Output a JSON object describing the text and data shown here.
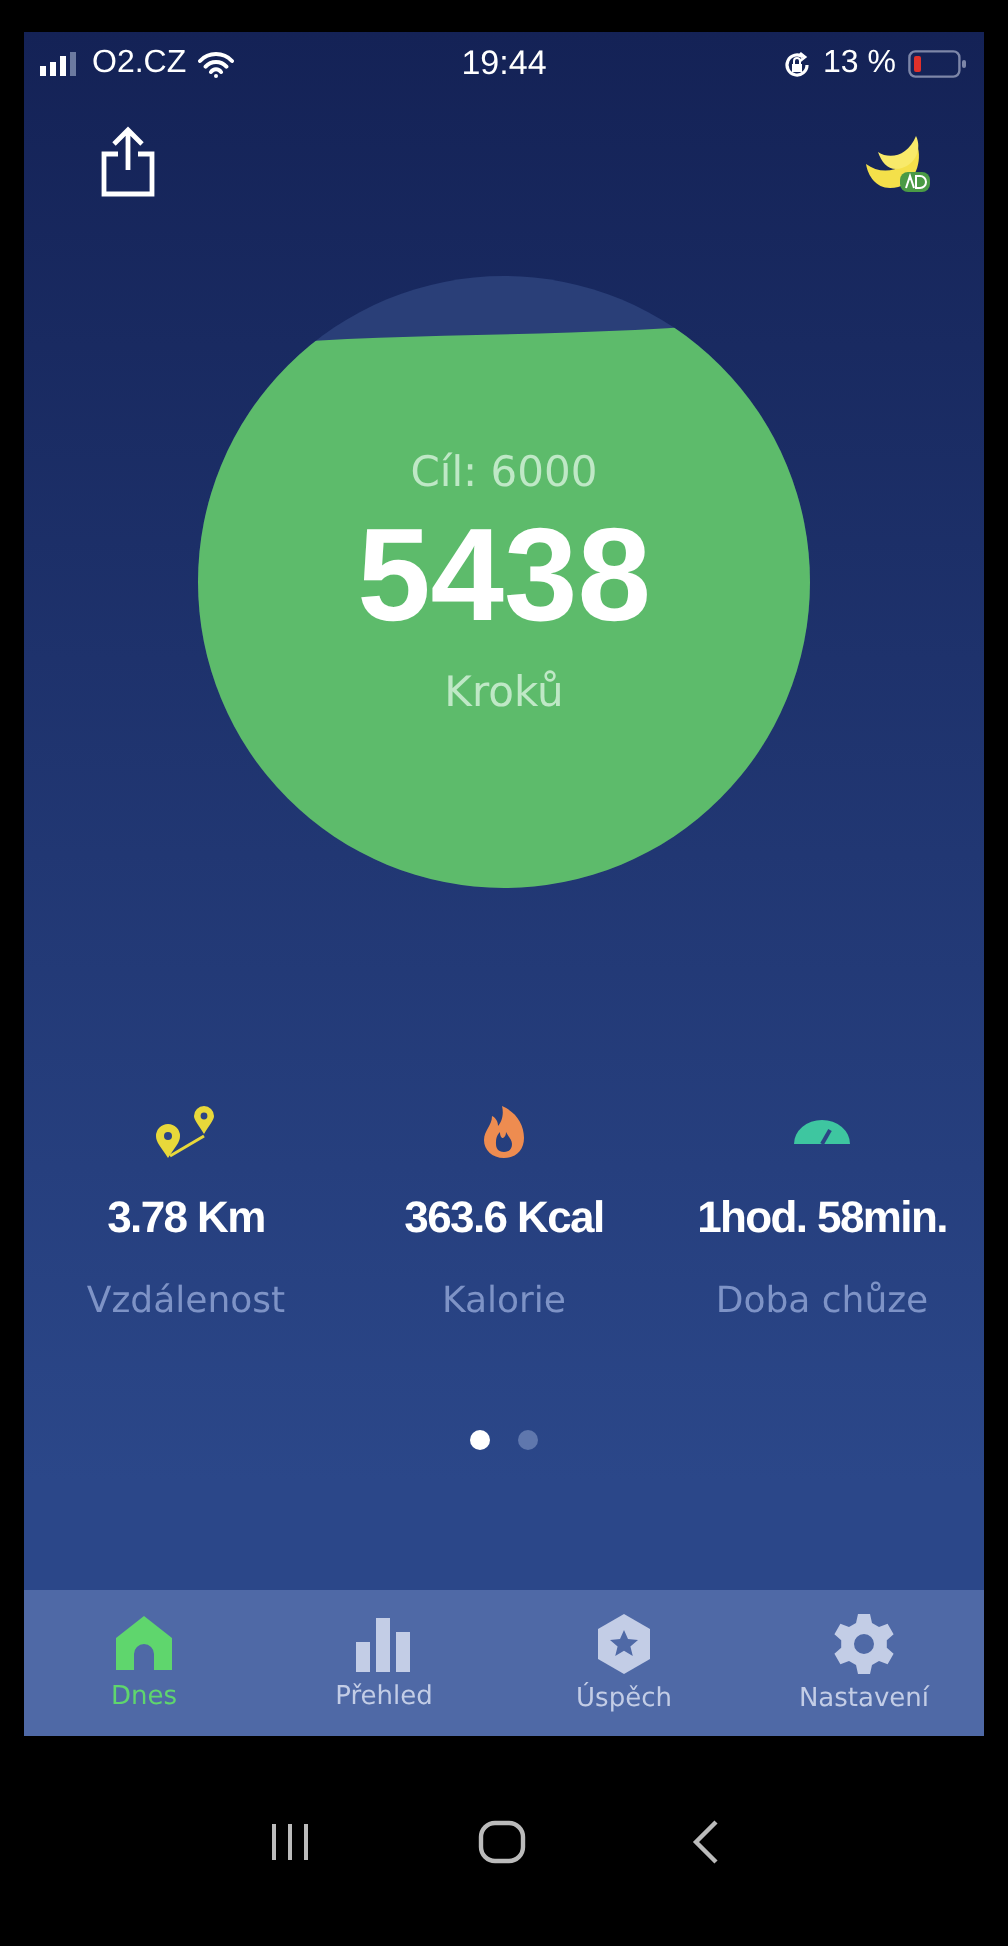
{
  "status_bar": {
    "carrier": "O2.CZ",
    "time": "19:44",
    "battery": "13 %"
  },
  "goal": {
    "label": "Cíl: 6000",
    "steps": "5438",
    "unit": "Kroků"
  },
  "stats": [
    {
      "kind": "distance",
      "value": "3.78 Km",
      "label": "Vzdálenost"
    },
    {
      "kind": "calories",
      "value": "363.6 Kcal",
      "label": "Kalorie"
    },
    {
      "kind": "time",
      "value": "1hod. 58min.",
      "label": "Doba chůze"
    }
  ],
  "pages": [
    {
      "selected": true
    },
    {
      "selected": false
    }
  ],
  "tabs": [
    {
      "kind": "home",
      "label": "Dnes",
      "selected": true
    },
    {
      "kind": "chart",
      "label": "Přehled",
      "selected": false
    },
    {
      "kind": "badge",
      "label": "Úspěch",
      "selected": false
    },
    {
      "kind": "settings",
      "label": "Nastavení",
      "selected": false
    }
  ]
}
